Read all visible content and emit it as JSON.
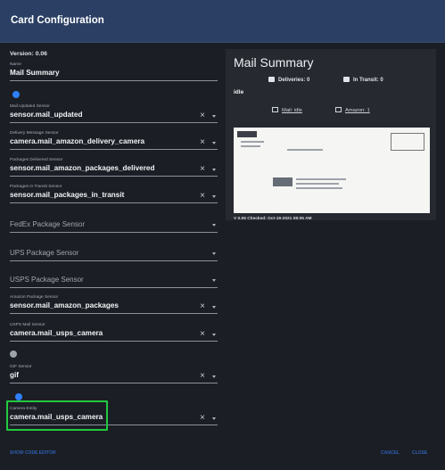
{
  "dialog": {
    "title": "Card Configuration",
    "version": "Version: 0.06"
  },
  "fields": {
    "name": {
      "label": "Name",
      "value": "Mail Summary"
    },
    "mail_updated": {
      "label": "Mail Updated Sensor",
      "value": "sensor.mail_updated"
    },
    "delivery_message": {
      "label": "Delivery Message Sensor",
      "value": "camera.mail_amazon_delivery_camera"
    },
    "packages_delivered": {
      "label": "Packages Delivered Sensor",
      "value": "sensor.mail_amazon_packages_delivered"
    },
    "packages_in_transit": {
      "label": "Packages in Transit Sensor",
      "value": "sensor.mail_packages_in_transit"
    },
    "fedex": {
      "placeholder": "FedEx Package Sensor"
    },
    "ups": {
      "placeholder": "UPS Package Sensor"
    },
    "usps": {
      "placeholder": "USPS Package Sensor"
    },
    "amazon": {
      "label": "Amazon Package Sensor",
      "value": "sensor.mail_amazon_packages"
    },
    "usps_mail": {
      "label": "USPS Mail Sensor",
      "value": "camera.mail_usps_camera"
    },
    "gif": {
      "label": "GIF Sensor",
      "value": "gif"
    },
    "camera_entity": {
      "label": "Camera Entity",
      "value": "camera.mail_usps_camera"
    }
  },
  "toggles": {
    "first": {
      "on": true
    },
    "gif_toggle": {
      "on": false
    },
    "camera_toggle": {
      "on": true
    }
  },
  "preview": {
    "title": "Mail Summary",
    "deliveries": "Deliveries: 0",
    "in_transit": "In Transit: 0",
    "status": "idle",
    "mail_link": "Mail: idle",
    "amazon_link": "Amazon: 1",
    "checked": "V 0.06 Checked: Oct-19-2021 08:05 AM"
  },
  "footer": {
    "show_code_editor": "SHOW CODE EDITOR",
    "cancel": "CANCEL",
    "close": "CLOSE"
  },
  "icons": {
    "clear": "×"
  },
  "colors": {
    "header_bg": "#2a3f63",
    "dialog_bg": "#1b1e24",
    "accent": "#2f80ff",
    "highlight": "#22c940"
  }
}
